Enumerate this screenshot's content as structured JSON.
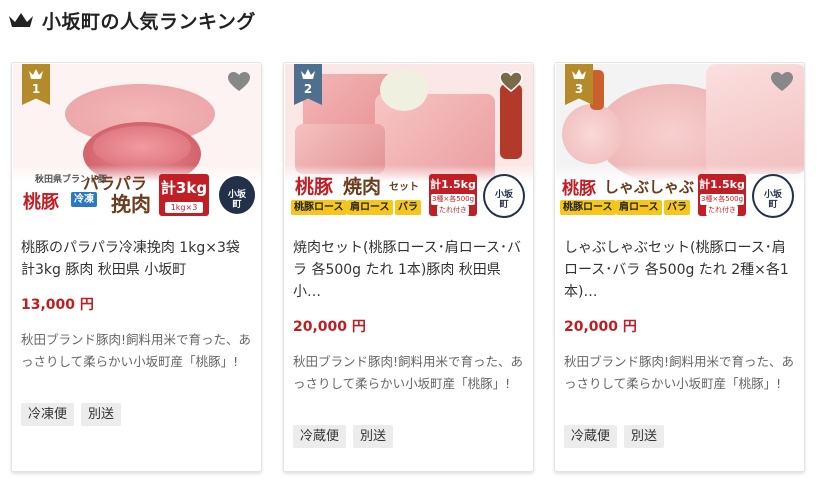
{
  "header": {
    "title": "小坂町の人気ランキング",
    "icon": "crown-icon"
  },
  "accent": {
    "gold": "#b58a2b",
    "blue": "#4f6f8f",
    "price": "#bf1d22"
  },
  "cards": [
    {
      "rank": "1",
      "image": {
        "small_label": "秋田県ブランド豚",
        "brand": "桃豚",
        "title_line1": "パラパラ",
        "title_line2": "挽肉",
        "frozen": "冷凍",
        "kg": "計3kg",
        "kg_sub": "1kg×3",
        "logo_main": "小坂町",
        "logo_top": "秋田県"
      },
      "name": "桃豚のパラパラ冷凍挽肉 1kg×3袋 計3kg 豚肉 秋田県 小坂町",
      "price": "13,000 円",
      "desc": "秋田ブランド豚肉!飼料用米で育った、あっさりして柔らかい小坂町産「桃豚」!",
      "tags": [
        "冷凍便",
        "別送"
      ]
    },
    {
      "rank": "2",
      "image": {
        "brand": "桃豚",
        "title": "焼肉",
        "set": "セット",
        "pill1": "桃豚ロース",
        "pill2": "肩ロース",
        "pill3": "バラ",
        "kg": "計1.5kg",
        "kg_sub": "3種×各500g",
        "kg_sub2": "たれ付き",
        "logo_main": "小坂町",
        "logo_top": "秋田県"
      },
      "name": "焼肉セット(桃豚ロース･肩ロース･バラ 各500g たれ 1本)豚肉 秋田県 小…",
      "price": "20,000 円",
      "desc": "秋田ブランド豚肉!飼料用米で育った、あっさりして柔らかい小坂町産「桃豚」!",
      "tags": [
        "冷蔵便",
        "別送"
      ]
    },
    {
      "rank": "3",
      "image": {
        "brand": "桃豚",
        "title": "しゃぶしゃぶ",
        "pill1": "桃豚ロース",
        "pill2": "肩ロース",
        "pill3": "バラ",
        "kg": "計1.5kg",
        "kg_sub": "3種×各500g",
        "kg_sub2": "たれ付き",
        "logo_main": "小坂町",
        "logo_top": "秋田県"
      },
      "name": "しゃぶしゃぶセット(桃豚ロース･肩ロース･バラ 各500g たれ 2種×各1本)…",
      "price": "20,000 円",
      "desc": "秋田ブランド豚肉!飼料用米で育った、あっさりして柔らかい小坂町産「桃豚」!",
      "tags": [
        "冷蔵便",
        "別送"
      ]
    }
  ]
}
